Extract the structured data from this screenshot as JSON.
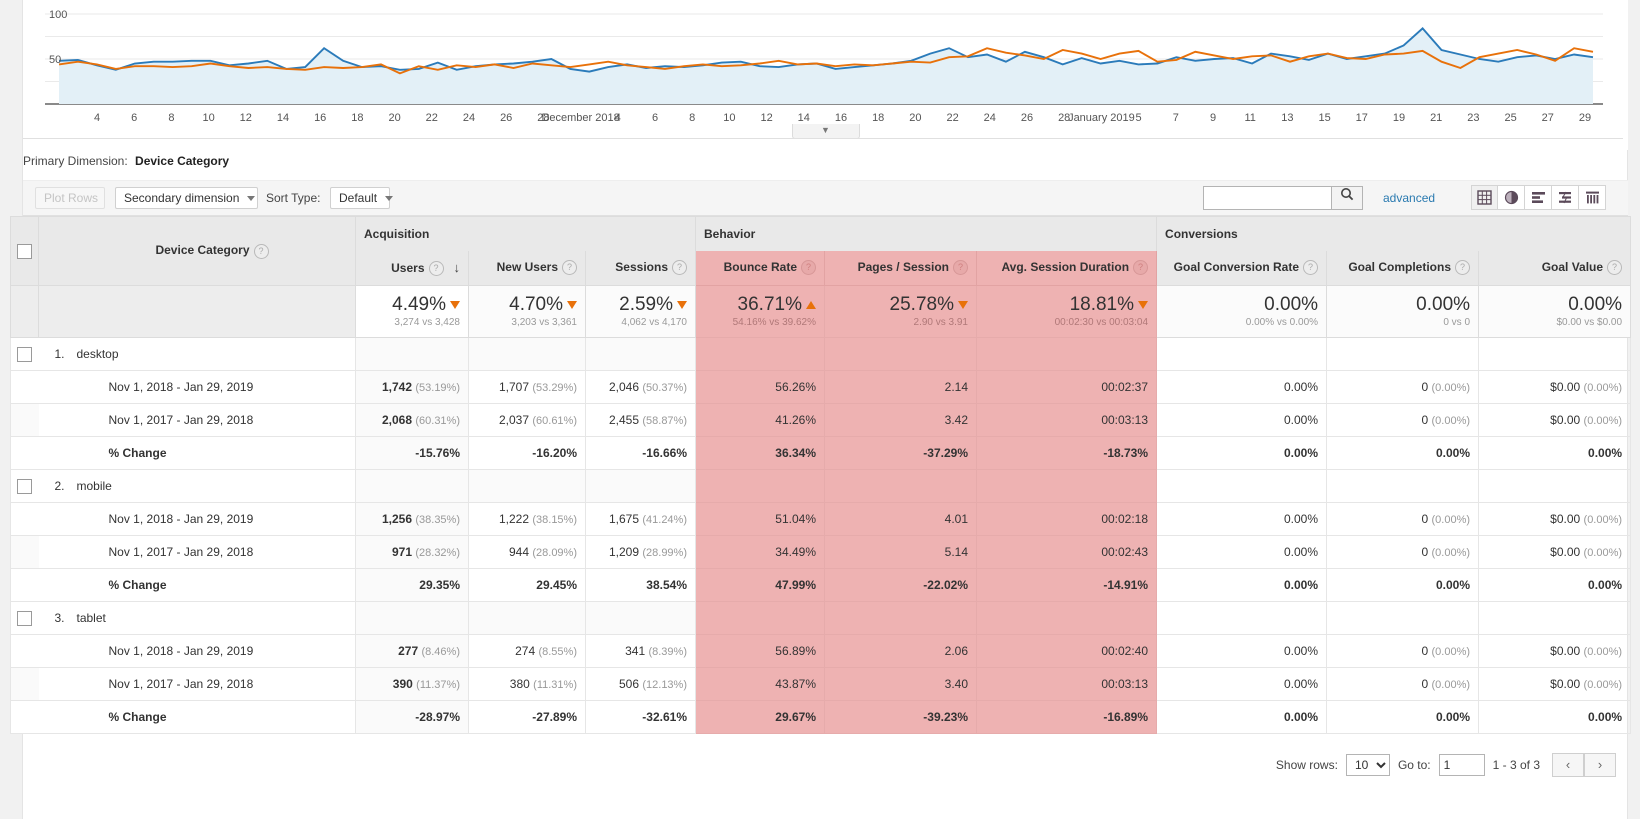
{
  "chart": {
    "y_label_top": "100",
    "y_label_mid": "50",
    "month_label_1": "December 2018",
    "month_label_2": "January 2019"
  },
  "chart_data": {
    "type": "line",
    "title": "",
    "xlabel": "",
    "ylabel": "",
    "ylim": [
      0,
      100
    ],
    "grid": true,
    "legend": "none",
    "tick_labels": [
      "4",
      "6",
      "8",
      "10",
      "12",
      "14",
      "16",
      "18",
      "20",
      "22",
      "24",
      "26",
      "28",
      "December 2018",
      "4",
      "6",
      "8",
      "10",
      "12",
      "14",
      "16",
      "18",
      "20",
      "22",
      "24",
      "26",
      "28",
      "January 2019",
      "5",
      "7",
      "9",
      "11",
      "13",
      "15",
      "17",
      "19",
      "21",
      "23",
      "25",
      "27",
      "29"
    ],
    "series": [
      {
        "name": "Nov 1, 2018 - Jan 29, 2019",
        "color": "#2b7bba",
        "values": [
          48,
          49,
          43,
          38,
          45,
          47,
          47,
          48,
          48,
          43,
          45,
          48,
          39,
          41,
          62,
          48,
          41,
          42,
          38,
          39,
          46,
          38,
          42,
          44,
          45,
          47,
          50,
          39,
          36,
          41,
          44,
          40,
          42,
          41,
          43,
          46,
          47,
          42,
          41,
          44,
          45,
          39,
          41,
          43,
          45,
          48,
          56,
          62,
          52,
          55,
          47,
          58,
          52,
          44,
          51,
          45,
          48,
          44,
          45,
          52,
          48,
          50,
          51,
          45,
          56,
          53,
          49,
          56,
          50,
          53,
          56,
          65,
          84,
          60,
          55,
          50,
          47,
          52,
          54,
          50,
          55,
          52
        ]
      },
      {
        "name": "Nov 1, 2017 - Jan 29, 2018",
        "color": "#e8710a",
        "values": [
          44,
          47,
          44,
          39,
          42,
          42,
          41,
          42,
          45,
          42,
          40,
          41,
          39,
          38,
          41,
          40,
          41,
          44,
          34,
          42,
          38,
          43,
          41,
          44,
          40,
          45,
          43,
          41,
          44,
          47,
          43,
          41,
          39,
          42,
          44,
          42,
          43,
          45,
          48,
          44,
          45,
          42,
          44,
          43,
          45,
          47,
          46,
          52,
          53,
          62,
          57,
          54,
          50,
          60,
          56,
          50,
          56,
          59,
          47,
          49,
          58,
          54,
          50,
          53,
          54,
          47,
          53,
          56,
          51,
          50,
          55,
          56,
          59,
          47,
          40,
          52,
          56,
          60,
          55,
          48,
          62,
          58
        ]
      }
    ]
  },
  "primary_dimension": {
    "label": "Primary Dimension:",
    "value": "Device Category"
  },
  "toolbar": {
    "plot_rows": "Plot Rows",
    "secondary_dimension": "Secondary dimension",
    "sort_type_label": "Sort Type:",
    "sort_type_value": "Default",
    "search_placeholder": "",
    "search_value": "",
    "advanced": "advanced",
    "view_icons": [
      "table-view-icon",
      "pie-view-icon",
      "performance-view-icon",
      "comparison-view-icon",
      "pivot-view-icon"
    ]
  },
  "table": {
    "groups": [
      {
        "name": "",
        "label": ""
      },
      {
        "name": "acquisition",
        "label": "Acquisition"
      },
      {
        "name": "behavior",
        "label": "Behavior"
      },
      {
        "name": "conversions",
        "label": "Conversions"
      }
    ],
    "dimension_header": "Device Category",
    "columns": [
      {
        "label": "Users",
        "sorted": true,
        "highlight": false
      },
      {
        "label": "New Users",
        "sorted": false,
        "highlight": false
      },
      {
        "label": "Sessions",
        "sorted": false,
        "highlight": false
      },
      {
        "label": "Bounce Rate",
        "sorted": false,
        "highlight": true
      },
      {
        "label": "Pages / Session",
        "sorted": false,
        "highlight": true
      },
      {
        "label": "Avg. Session Duration",
        "sorted": false,
        "highlight": true
      },
      {
        "label": "Goal Conversion Rate",
        "sorted": false,
        "highlight": false
      },
      {
        "label": "Goal Completions",
        "sorted": false,
        "highlight": false
      },
      {
        "label": "Goal Value",
        "sorted": false,
        "highlight": false
      }
    ],
    "summary": [
      {
        "value": "4.49%",
        "direction": "down",
        "compare": "3,274 vs 3,428",
        "highlight": false
      },
      {
        "value": "4.70%",
        "direction": "down",
        "compare": "3,203 vs 3,361",
        "highlight": false
      },
      {
        "value": "2.59%",
        "direction": "down",
        "compare": "4,062 vs 4,170",
        "highlight": false
      },
      {
        "value": "36.71%",
        "direction": "up",
        "compare": "54.16% vs 39.62%",
        "highlight": true
      },
      {
        "value": "25.78%",
        "direction": "down",
        "compare": "2.90 vs 3.91",
        "highlight": true
      },
      {
        "value": "18.81%",
        "direction": "down",
        "compare": "00:02:30 vs 00:03:04",
        "highlight": true
      },
      {
        "value": "0.00%",
        "direction": "none",
        "compare": "0.00% vs 0.00%",
        "highlight": false
      },
      {
        "value": "0.00%",
        "direction": "none",
        "compare": "0 vs 0",
        "highlight": false
      },
      {
        "value": "0.00%",
        "direction": "none",
        "compare": "$0.00 vs $0.00",
        "highlight": false
      }
    ],
    "rows": [
      {
        "rank": "1.",
        "name": "desktop",
        "periods": [
          {
            "label": "Nov 1, 2018 - Jan 29, 2019",
            "users": "1,742",
            "users_pct": "(53.19%)",
            "new_users": "1,707",
            "new_users_pct": "(53.29%)",
            "sessions": "2,046",
            "sessions_pct": "(50.37%)",
            "bounce_rate": "56.26%",
            "pages_session": "2.14",
            "avg_duration": "00:02:37",
            "goal_rate": "0.00%",
            "goal_completions": "0",
            "goal_completions_pct": "(0.00%)",
            "goal_value": "$0.00",
            "goal_value_pct": "(0.00%)"
          },
          {
            "label": "Nov 1, 2017 - Jan 29, 2018",
            "users": "2,068",
            "users_pct": "(60.31%)",
            "new_users": "2,037",
            "new_users_pct": "(60.61%)",
            "sessions": "2,455",
            "sessions_pct": "(58.87%)",
            "bounce_rate": "41.26%",
            "pages_session": "3.42",
            "avg_duration": "00:03:13",
            "goal_rate": "0.00%",
            "goal_completions": "0",
            "goal_completions_pct": "(0.00%)",
            "goal_value": "$0.00",
            "goal_value_pct": "(0.00%)"
          }
        ],
        "change": {
          "label": "% Change",
          "users": "-15.76%",
          "new_users": "-16.20%",
          "sessions": "-16.66%",
          "bounce_rate": "36.34%",
          "pages_session": "-37.29%",
          "avg_duration": "-18.73%",
          "goal_rate": "0.00%",
          "goal_completions": "0.00%",
          "goal_value": "0.00%"
        }
      },
      {
        "rank": "2.",
        "name": "mobile",
        "periods": [
          {
            "label": "Nov 1, 2018 - Jan 29, 2019",
            "users": "1,256",
            "users_pct": "(38.35%)",
            "new_users": "1,222",
            "new_users_pct": "(38.15%)",
            "sessions": "1,675",
            "sessions_pct": "(41.24%)",
            "bounce_rate": "51.04%",
            "pages_session": "4.01",
            "avg_duration": "00:02:18",
            "goal_rate": "0.00%",
            "goal_completions": "0",
            "goal_completions_pct": "(0.00%)",
            "goal_value": "$0.00",
            "goal_value_pct": "(0.00%)"
          },
          {
            "label": "Nov 1, 2017 - Jan 29, 2018",
            "users": "971",
            "users_pct": "(28.32%)",
            "new_users": "944",
            "new_users_pct": "(28.09%)",
            "sessions": "1,209",
            "sessions_pct": "(28.99%)",
            "bounce_rate": "34.49%",
            "pages_session": "5.14",
            "avg_duration": "00:02:43",
            "goal_rate": "0.00%",
            "goal_completions": "0",
            "goal_completions_pct": "(0.00%)",
            "goal_value": "$0.00",
            "goal_value_pct": "(0.00%)"
          }
        ],
        "change": {
          "label": "% Change",
          "users": "29.35%",
          "new_users": "29.45%",
          "sessions": "38.54%",
          "bounce_rate": "47.99%",
          "pages_session": "-22.02%",
          "avg_duration": "-14.91%",
          "goal_rate": "0.00%",
          "goal_completions": "0.00%",
          "goal_value": "0.00%"
        }
      },
      {
        "rank": "3.",
        "name": "tablet",
        "periods": [
          {
            "label": "Nov 1, 2018 - Jan 29, 2019",
            "users": "277",
            "users_pct": "(8.46%)",
            "new_users": "274",
            "new_users_pct": "(8.55%)",
            "sessions": "341",
            "sessions_pct": "(8.39%)",
            "bounce_rate": "56.89%",
            "pages_session": "2.06",
            "avg_duration": "00:02:40",
            "goal_rate": "0.00%",
            "goal_completions": "0",
            "goal_completions_pct": "(0.00%)",
            "goal_value": "$0.00",
            "goal_value_pct": "(0.00%)"
          },
          {
            "label": "Nov 1, 2017 - Jan 29, 2018",
            "users": "390",
            "users_pct": "(11.37%)",
            "new_users": "380",
            "new_users_pct": "(11.31%)",
            "sessions": "506",
            "sessions_pct": "(12.13%)",
            "bounce_rate": "43.87%",
            "pages_session": "3.40",
            "avg_duration": "00:03:13",
            "goal_rate": "0.00%",
            "goal_completions": "0",
            "goal_completions_pct": "(0.00%)",
            "goal_value": "$0.00",
            "goal_value_pct": "(0.00%)"
          }
        ],
        "change": {
          "label": "% Change",
          "users": "-28.97%",
          "new_users": "-27.89%",
          "sessions": "-32.61%",
          "bounce_rate": "29.67%",
          "pages_session": "-39.23%",
          "avg_duration": "-16.89%",
          "goal_rate": "0.00%",
          "goal_completions": "0.00%",
          "goal_value": "0.00%"
        }
      }
    ]
  },
  "footer": {
    "show_rows_label": "Show rows:",
    "show_rows_value": "10",
    "goto_label": "Go to:",
    "goto_value": "1",
    "range": "1 - 3 of 3",
    "prev": "‹",
    "next": "›"
  }
}
